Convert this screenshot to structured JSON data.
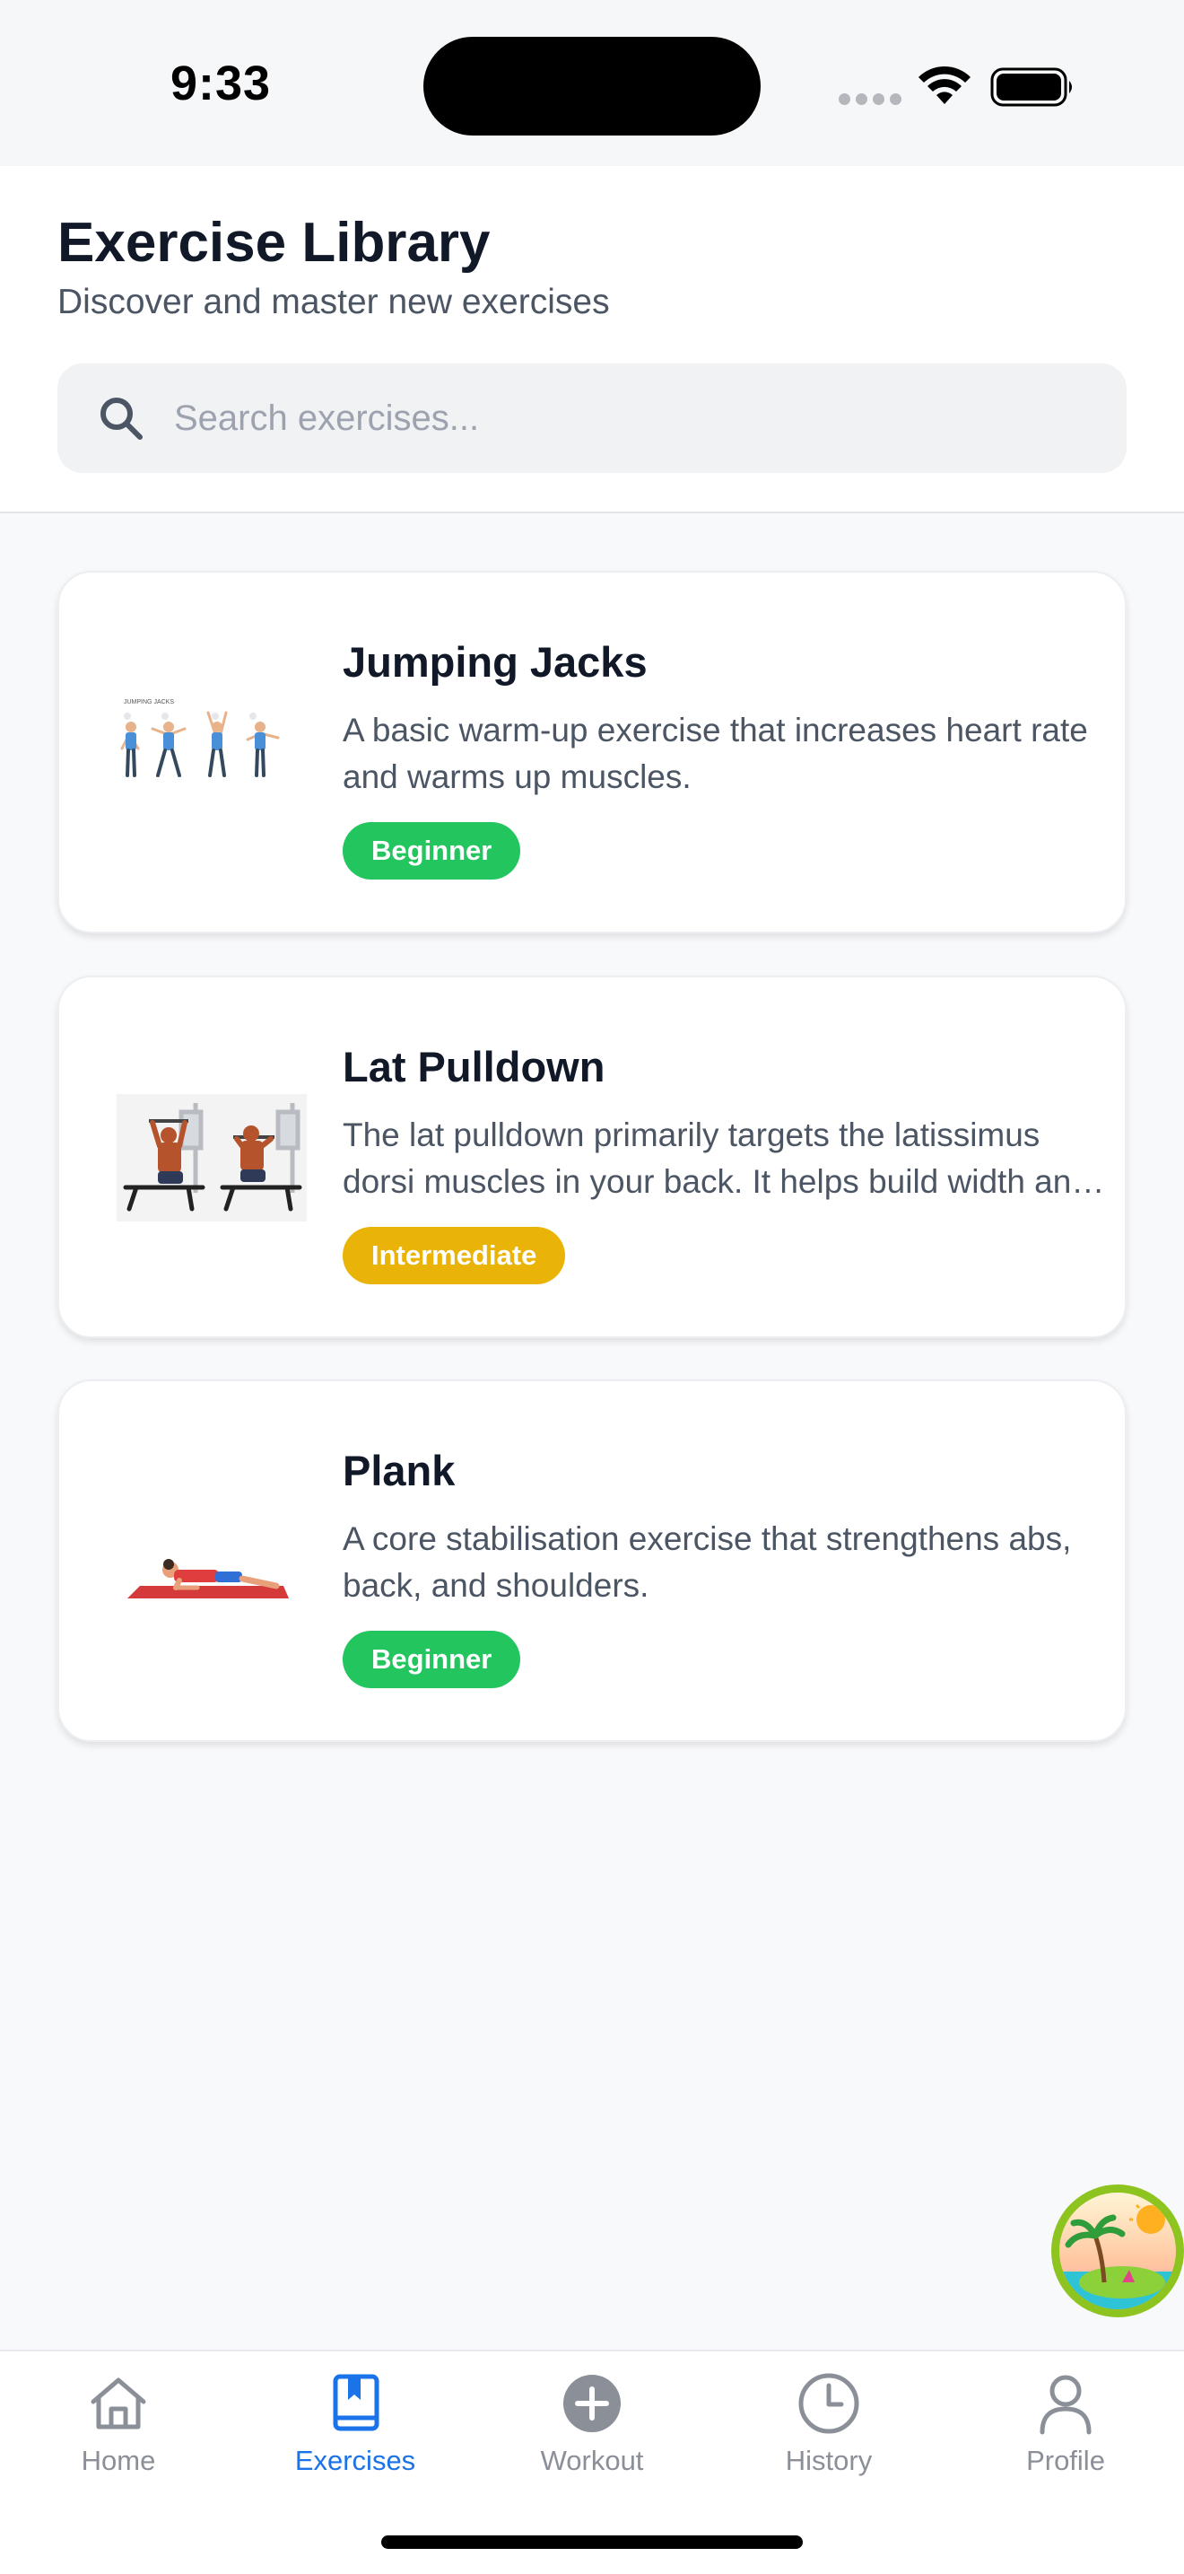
{
  "status_bar": {
    "time": "9:33"
  },
  "header": {
    "title": "Exercise Library",
    "subtitle": "Discover and master new exercises"
  },
  "search": {
    "placeholder": "Search exercises...",
    "value": ""
  },
  "exercises": [
    {
      "name": "Jumping Jacks",
      "description": "A basic warm-up exercise that increases heart rate and warms up muscles.",
      "level": "Beginner",
      "level_color": "#22c55e",
      "thumb_caption": "JUMPING JACKS"
    },
    {
      "name": "Lat Pulldown",
      "description": "The lat pulldown primarily targets the latissimus dorsi muscles in your back. It helps build width and strength in the upper body.",
      "level": "Intermediate",
      "level_color": "#eab308"
    },
    {
      "name": "Plank",
      "description": "A core stabilisation exercise that strengthens abs, back, and shoulders.",
      "level": "Beginner",
      "level_color": "#22c55e"
    }
  ],
  "tabs": [
    {
      "label": "Home",
      "icon": "home-icon",
      "active": false
    },
    {
      "label": "Exercises",
      "icon": "book-icon",
      "active": true
    },
    {
      "label": "Workout",
      "icon": "plus-circle-icon",
      "active": false
    },
    {
      "label": "History",
      "icon": "clock-icon",
      "active": false
    },
    {
      "label": "Profile",
      "icon": "person-icon",
      "active": false
    }
  ],
  "colors": {
    "accent": "#1a73e8",
    "inactive": "#8a8f98",
    "beginner": "#22c55e",
    "intermediate": "#eab308"
  }
}
